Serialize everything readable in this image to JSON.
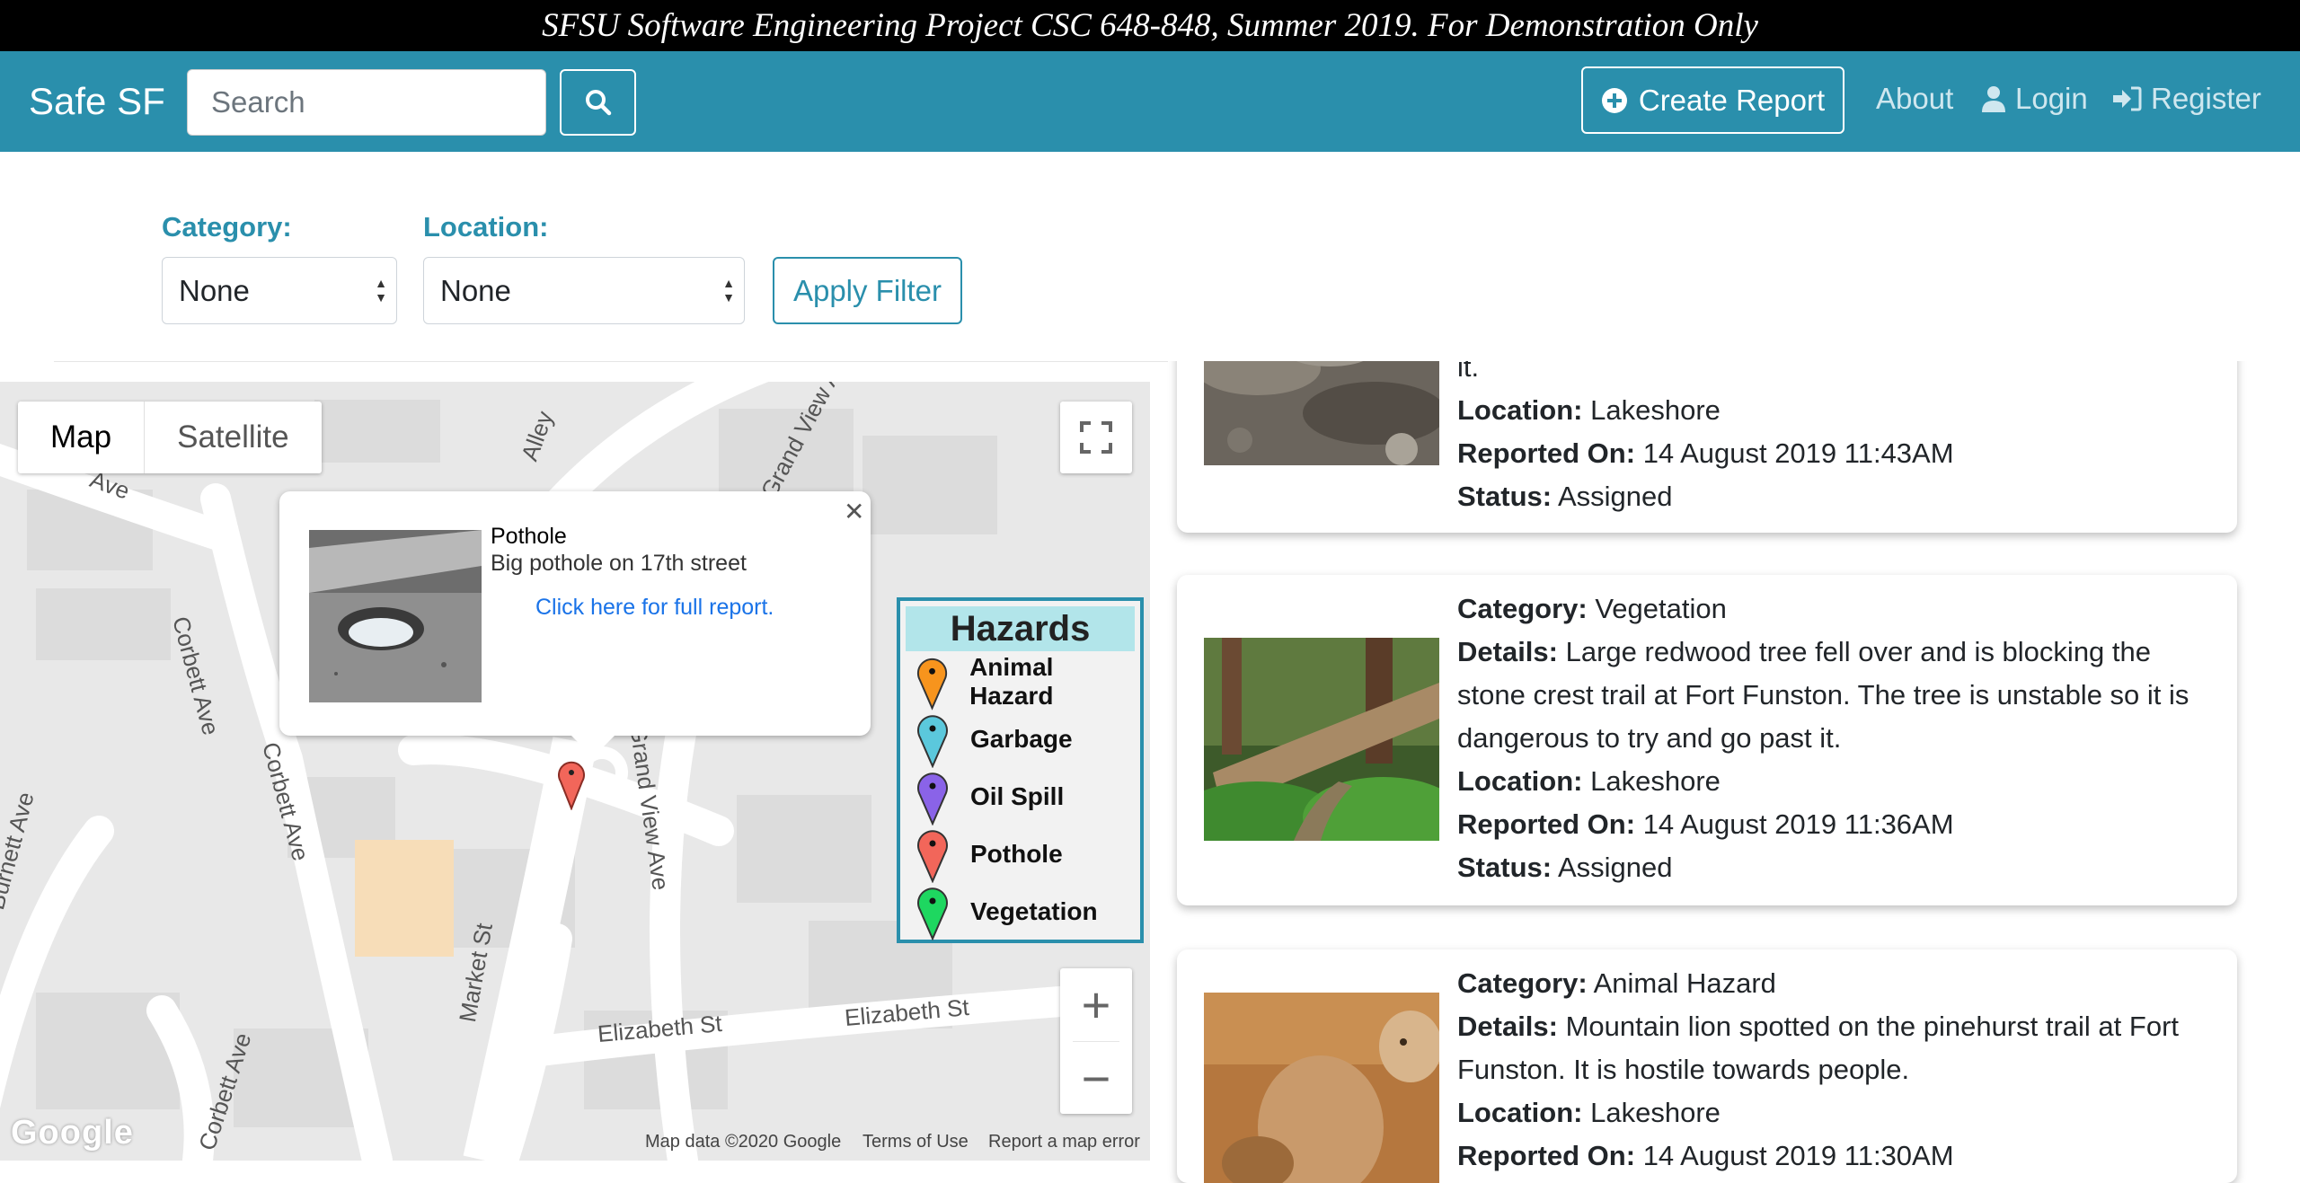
{
  "banner": "SFSU Software Engineering Project CSC 648-848, Summer 2019. For Demonstration Only",
  "navbar": {
    "brand": "Safe SF",
    "search_placeholder": "Search",
    "search_icon": "search-icon",
    "create_report": "Create Report",
    "about": "About",
    "login": "Login",
    "register": "Register"
  },
  "filters": {
    "category_label": "Category:",
    "category_value": "None",
    "location_label": "Location:",
    "location_value": "None",
    "apply_label": "Apply Filter"
  },
  "map": {
    "map_label": "Map",
    "satellite_label": "Satellite",
    "streets": [
      "Alley",
      "Grand View Ave",
      "Ave",
      "Corbett Ave",
      "Corbett Ave",
      "Grand View Ave",
      "Burnett Ave",
      "Market St",
      "Elizabeth St",
      "Elizabeth St",
      "Corbett Ave"
    ],
    "popup": {
      "title": "Pothole",
      "description": "Big pothole on 17th street",
      "link": "Click here for full report."
    },
    "legend": {
      "title": "Hazards",
      "items": [
        {
          "label": "Animal Hazard",
          "color": "#f7941d"
        },
        {
          "label": "Garbage",
          "color": "#5bc8dc"
        },
        {
          "label": "Oil Spill",
          "color": "#8a63e8"
        },
        {
          "label": "Pothole",
          "color": "#f2665a"
        },
        {
          "label": "Vegetation",
          "color": "#1ed760"
        }
      ]
    },
    "google": "Google",
    "attribution": [
      "Map data ©2020 Google",
      "Terms of Use",
      "Report a map error"
    ]
  },
  "reports": [
    {
      "partial_text": "it.",
      "location_label": "Location:",
      "location": "Lakeshore",
      "reported_label": "Reported On:",
      "reported": "14 August 2019 11:43AM",
      "status_label": "Status:",
      "status": "Assigned"
    },
    {
      "category_label": "Category:",
      "category": "Vegetation",
      "details_label": "Details:",
      "details": "Large redwood tree fell over and is blocking the stone crest trail at Fort Funston. The tree is unstable so it is dangerous to try and go past it.",
      "location_label": "Location:",
      "location": "Lakeshore",
      "reported_label": "Reported On:",
      "reported": "14 August 2019 11:36AM",
      "status_label": "Status:",
      "status": "Assigned"
    },
    {
      "category_label": "Category:",
      "category": "Animal Hazard",
      "details_label": "Details:",
      "details": "Mountain lion spotted on the pinehurst trail at Fort Funston. It is hostile towards people.",
      "location_label": "Location:",
      "location": "Lakeshore",
      "reported_label": "Reported On:",
      "reported": "14 August 2019 11:30AM"
    }
  ]
}
